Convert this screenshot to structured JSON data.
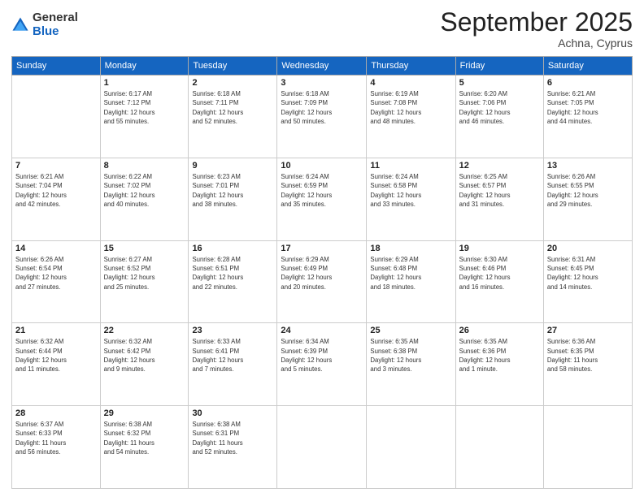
{
  "header": {
    "logo_general": "General",
    "logo_blue": "Blue",
    "month_title": "September 2025",
    "subtitle": "Achna, Cyprus"
  },
  "weekdays": [
    "Sunday",
    "Monday",
    "Tuesday",
    "Wednesday",
    "Thursday",
    "Friday",
    "Saturday"
  ],
  "weeks": [
    [
      {
        "day": "",
        "info": ""
      },
      {
        "day": "1",
        "info": "Sunrise: 6:17 AM\nSunset: 7:12 PM\nDaylight: 12 hours\nand 55 minutes."
      },
      {
        "day": "2",
        "info": "Sunrise: 6:18 AM\nSunset: 7:11 PM\nDaylight: 12 hours\nand 52 minutes."
      },
      {
        "day": "3",
        "info": "Sunrise: 6:18 AM\nSunset: 7:09 PM\nDaylight: 12 hours\nand 50 minutes."
      },
      {
        "day": "4",
        "info": "Sunrise: 6:19 AM\nSunset: 7:08 PM\nDaylight: 12 hours\nand 48 minutes."
      },
      {
        "day": "5",
        "info": "Sunrise: 6:20 AM\nSunset: 7:06 PM\nDaylight: 12 hours\nand 46 minutes."
      },
      {
        "day": "6",
        "info": "Sunrise: 6:21 AM\nSunset: 7:05 PM\nDaylight: 12 hours\nand 44 minutes."
      }
    ],
    [
      {
        "day": "7",
        "info": "Sunrise: 6:21 AM\nSunset: 7:04 PM\nDaylight: 12 hours\nand 42 minutes."
      },
      {
        "day": "8",
        "info": "Sunrise: 6:22 AM\nSunset: 7:02 PM\nDaylight: 12 hours\nand 40 minutes."
      },
      {
        "day": "9",
        "info": "Sunrise: 6:23 AM\nSunset: 7:01 PM\nDaylight: 12 hours\nand 38 minutes."
      },
      {
        "day": "10",
        "info": "Sunrise: 6:24 AM\nSunset: 6:59 PM\nDaylight: 12 hours\nand 35 minutes."
      },
      {
        "day": "11",
        "info": "Sunrise: 6:24 AM\nSunset: 6:58 PM\nDaylight: 12 hours\nand 33 minutes."
      },
      {
        "day": "12",
        "info": "Sunrise: 6:25 AM\nSunset: 6:57 PM\nDaylight: 12 hours\nand 31 minutes."
      },
      {
        "day": "13",
        "info": "Sunrise: 6:26 AM\nSunset: 6:55 PM\nDaylight: 12 hours\nand 29 minutes."
      }
    ],
    [
      {
        "day": "14",
        "info": "Sunrise: 6:26 AM\nSunset: 6:54 PM\nDaylight: 12 hours\nand 27 minutes."
      },
      {
        "day": "15",
        "info": "Sunrise: 6:27 AM\nSunset: 6:52 PM\nDaylight: 12 hours\nand 25 minutes."
      },
      {
        "day": "16",
        "info": "Sunrise: 6:28 AM\nSunset: 6:51 PM\nDaylight: 12 hours\nand 22 minutes."
      },
      {
        "day": "17",
        "info": "Sunrise: 6:29 AM\nSunset: 6:49 PM\nDaylight: 12 hours\nand 20 minutes."
      },
      {
        "day": "18",
        "info": "Sunrise: 6:29 AM\nSunset: 6:48 PM\nDaylight: 12 hours\nand 18 minutes."
      },
      {
        "day": "19",
        "info": "Sunrise: 6:30 AM\nSunset: 6:46 PM\nDaylight: 12 hours\nand 16 minutes."
      },
      {
        "day": "20",
        "info": "Sunrise: 6:31 AM\nSunset: 6:45 PM\nDaylight: 12 hours\nand 14 minutes."
      }
    ],
    [
      {
        "day": "21",
        "info": "Sunrise: 6:32 AM\nSunset: 6:44 PM\nDaylight: 12 hours\nand 11 minutes."
      },
      {
        "day": "22",
        "info": "Sunrise: 6:32 AM\nSunset: 6:42 PM\nDaylight: 12 hours\nand 9 minutes."
      },
      {
        "day": "23",
        "info": "Sunrise: 6:33 AM\nSunset: 6:41 PM\nDaylight: 12 hours\nand 7 minutes."
      },
      {
        "day": "24",
        "info": "Sunrise: 6:34 AM\nSunset: 6:39 PM\nDaylight: 12 hours\nand 5 minutes."
      },
      {
        "day": "25",
        "info": "Sunrise: 6:35 AM\nSunset: 6:38 PM\nDaylight: 12 hours\nand 3 minutes."
      },
      {
        "day": "26",
        "info": "Sunrise: 6:35 AM\nSunset: 6:36 PM\nDaylight: 12 hours\nand 1 minute."
      },
      {
        "day": "27",
        "info": "Sunrise: 6:36 AM\nSunset: 6:35 PM\nDaylight: 11 hours\nand 58 minutes."
      }
    ],
    [
      {
        "day": "28",
        "info": "Sunrise: 6:37 AM\nSunset: 6:33 PM\nDaylight: 11 hours\nand 56 minutes."
      },
      {
        "day": "29",
        "info": "Sunrise: 6:38 AM\nSunset: 6:32 PM\nDaylight: 11 hours\nand 54 minutes."
      },
      {
        "day": "30",
        "info": "Sunrise: 6:38 AM\nSunset: 6:31 PM\nDaylight: 11 hours\nand 52 minutes."
      },
      {
        "day": "",
        "info": ""
      },
      {
        "day": "",
        "info": ""
      },
      {
        "day": "",
        "info": ""
      },
      {
        "day": "",
        "info": ""
      }
    ]
  ]
}
